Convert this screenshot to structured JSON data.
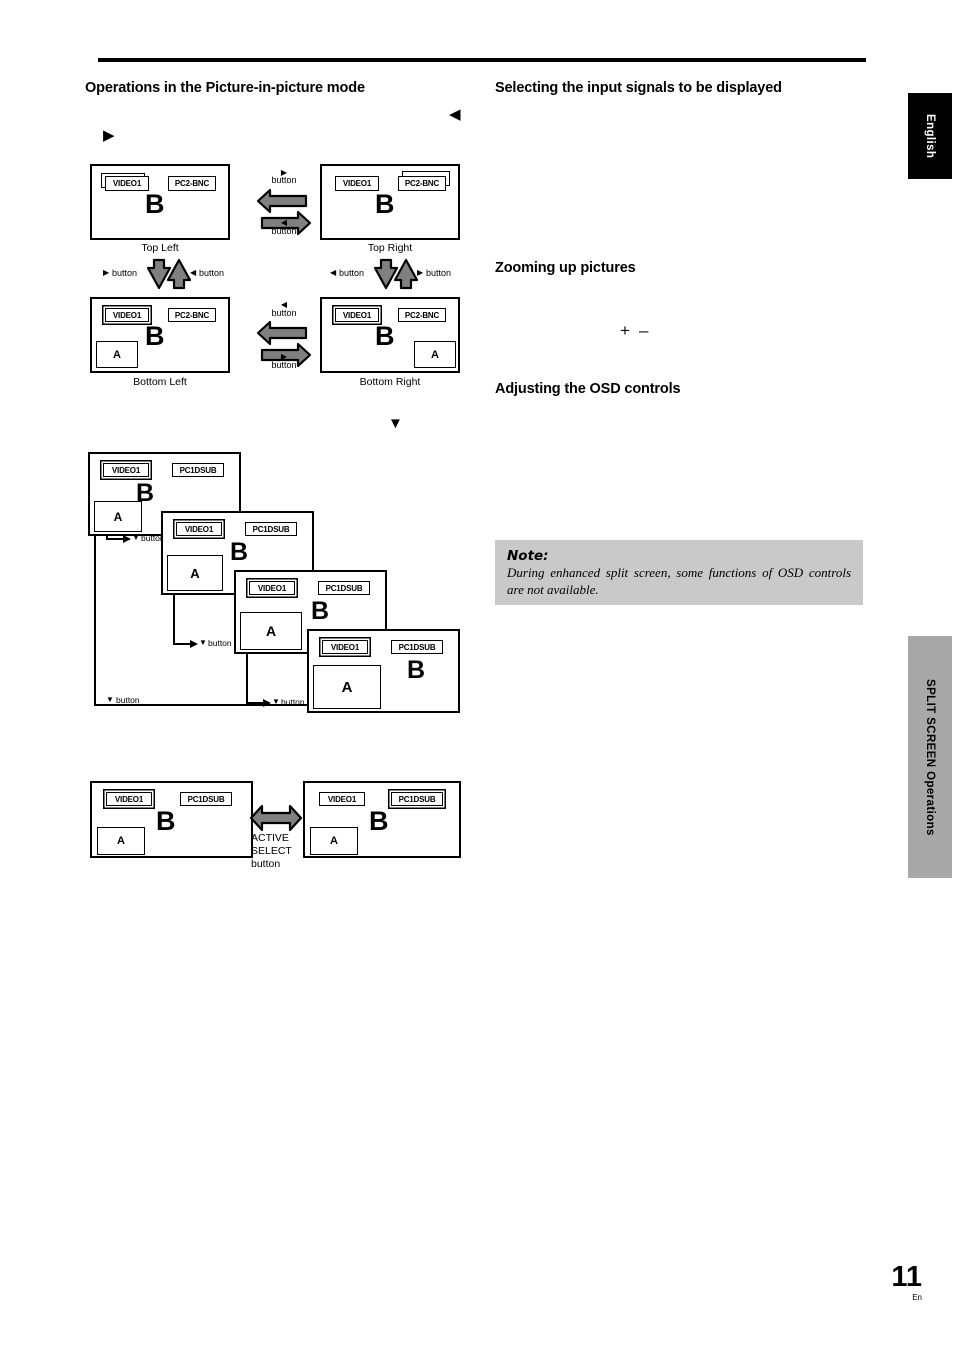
{
  "document": {
    "page_number": "11",
    "page_lang_code": "En",
    "side_tab_language": "English",
    "side_tab_section": "SPLIT SCREEN Operations"
  },
  "headings": {
    "left_main": "Operations in the Picture-in-picture mode",
    "right_select": "Selecting the input signals to be displayed",
    "right_zoom": "Zooming up pictures",
    "right_osd": "Adjusting the OSD controls"
  },
  "zoom_controls": {
    "plus": "+",
    "minus": "–"
  },
  "note": {
    "title": "Note:",
    "body": "During enhanced split screen, some functions of OSD controls are not available."
  },
  "markers": {
    "right_triangle": "▶",
    "left_triangle": "◀",
    "down_triangle": "▼"
  },
  "pip_grid": {
    "screens": [
      {
        "id": "top-left",
        "caption": "Top Left",
        "label_left": "VIDEO1",
        "label_right": "PC2-BNC",
        "active_label": "left",
        "main_letter": "B",
        "sub_letter": null,
        "sub_position": null
      },
      {
        "id": "top-right",
        "caption": "Top Right",
        "label_left": "VIDEO1",
        "label_right": "PC2-BNC",
        "active_label": "right",
        "main_letter": "B",
        "sub_letter": null,
        "sub_position": null
      },
      {
        "id": "bottom-left",
        "caption": "Bottom Left",
        "label_left": "VIDEO1",
        "label_right": "PC2-BNC",
        "active_label": "left-double",
        "main_letter": "B",
        "sub_letter": "A",
        "sub_position": "bottom-left"
      },
      {
        "id": "bottom-right",
        "caption": "Bottom Right",
        "label_left": "VIDEO1",
        "label_right": "PC2-BNC",
        "active_label": "left-double",
        "main_letter": "B",
        "sub_letter": "A",
        "sub_position": "bottom-right"
      }
    ],
    "horizontal_pair_top": {
      "top_button": "button",
      "top_marker": "▶",
      "bottom_button": "button",
      "bottom_marker": "◀"
    },
    "horizontal_pair_bottom": {
      "top_button": "button",
      "top_marker": "◀",
      "bottom_button": "button",
      "bottom_marker": "▶"
    },
    "vertical_pair_left": {
      "left_marker": "▶",
      "left_button": "button",
      "right_marker": "◀",
      "right_button": "button"
    },
    "vertical_pair_right": {
      "left_marker": "◀",
      "left_button": "button",
      "right_marker": "▶",
      "right_button": "button"
    }
  },
  "cascade": {
    "steps": [
      {
        "label_left": "VIDEO1",
        "label_right": "PC1DSUB",
        "main_letter": "B",
        "sub_letter": "A"
      },
      {
        "label_left": "VIDEO1",
        "label_right": "PC1DSUB",
        "main_letter": "B",
        "sub_letter": "A"
      },
      {
        "label_left": "VIDEO1",
        "label_right": "PC1DSUB",
        "main_letter": "B",
        "sub_letter": "A"
      },
      {
        "label_left": "VIDEO1",
        "label_right": "PC1DSUB",
        "main_letter": "B",
        "sub_letter": "A"
      }
    ],
    "connector_label": "button",
    "connector_marker": "▼",
    "connectors": [
      {
        "marker": "▼",
        "label": "button"
      },
      {
        "marker": "▼",
        "label": "button"
      },
      {
        "marker": "▼",
        "label": "button"
      },
      {
        "marker": "▼",
        "label": "button"
      }
    ]
  },
  "active_select": {
    "button_line1": "ACTIVE",
    "button_line2": "SELECT",
    "button_line3": "button",
    "left_screen": {
      "label_left": "VIDEO1",
      "label_right": "PC1DSUB",
      "active_label": "left",
      "main_letter": "B",
      "sub_letter": "A"
    },
    "right_screen": {
      "label_left": "VIDEO1",
      "label_right": "PC1DSUB",
      "active_label": "right",
      "main_letter": "B",
      "sub_letter": "A"
    }
  },
  "colors": {
    "arrow_fill": "#808080",
    "arrow_stroke": "#000000",
    "note_bg": "#c9c9c9",
    "tab_english_bg": "#000000",
    "tab_section_bg": "#a8a8a8"
  }
}
